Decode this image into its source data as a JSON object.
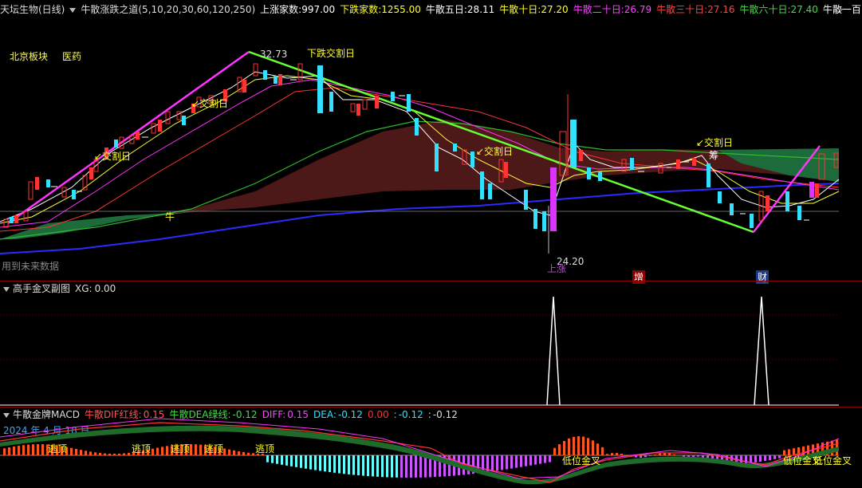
{
  "main_header": {
    "stock": "天坛生物(日线)",
    "indicator": "牛散涨跌之道(5,10,20,30,60,120,250)",
    "up_label": "上涨家数:",
    "up_value": "997.00",
    "down_label": "下跌家数:",
    "down_value": "1255.00",
    "ma5_label": "牛散五日:",
    "ma5_value": "28.11",
    "ma10_label": "牛散十日:",
    "ma10_value": "27.20",
    "ma20_label": "牛散二十日:",
    "ma20_value": "26.79",
    "ma30_label": "牛散三十日:",
    "ma30_value": "27.16",
    "ma60_label": "牛散六十日:",
    "ma60_value": "27.40",
    "ma100_label": "牛散一百"
  },
  "sectors": [
    "北京板块",
    "医药"
  ],
  "annotations": {
    "high_price": "32.73",
    "low_price": "24.20",
    "low_tag": "上涨",
    "down_cross": "下跌交割日",
    "cross1": "↙交割日",
    "cross2": "↙交割日",
    "cross3": "↙交割日",
    "cross4": "↙交割日",
    "buy_mark": "牛",
    "chip": "筹",
    "zeng": "增",
    "cai": "财",
    "future_note": "用到未来数据"
  },
  "sub1": {
    "title": "高手金叉副图",
    "xg_label": "XG:",
    "xg_value": "0.00"
  },
  "sub2": {
    "title": "牛散金牌MACD",
    "dif_label": "牛散DIF红线:",
    "dif_value": "0.15",
    "dea_label": "牛散DEA绿线:",
    "dea_value": "-0.12",
    "diff_label": "DIFF:",
    "diff_value": "0.15",
    "dea2_label": "DEA:",
    "dea2_value": "-0.12",
    "v1": "0.00",
    "v2": "-0.12",
    "v3": "-0.12",
    "date": "2024 年 4 月 18 日",
    "escape": [
      "逃顶",
      "逃顶",
      "逃顶",
      "逃顶",
      "逃顶"
    ],
    "low_cross1": "低位金叉",
    "low_cross2": "低位金叉",
    "low_cross3": "低位金叉"
  },
  "colors": {
    "up": "#ff3333",
    "down": "#33e0ff",
    "ma5": "#ffffff",
    "ma10": "#ffff00",
    "ma20": "#ff33ff",
    "ma30": "#ff3333",
    "ma60": "#33cc33",
    "ma250": "#2222ff"
  }
}
